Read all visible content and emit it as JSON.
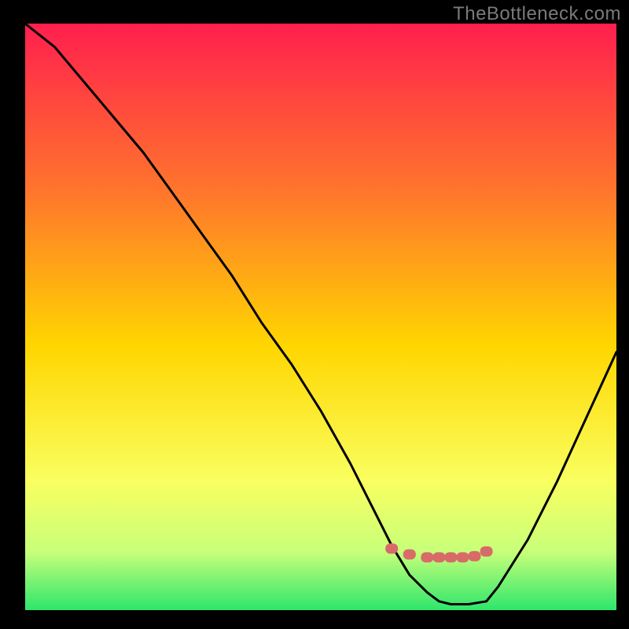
{
  "watermark": "TheBottleneck.com",
  "colors": {
    "black": "#000000",
    "grad_top": "#ff1f4e",
    "grad_mid1": "#ff7a2a",
    "grad_mid2": "#ffd600",
    "grad_mid3": "#f9ff60",
    "grad_bottom1": "#c8ff7a",
    "grad_bottom2": "#2ee66c",
    "curve_stroke": "#000000",
    "marker": "#d86a68"
  },
  "chart_data": {
    "type": "line",
    "title": "",
    "xlabel": "",
    "ylabel": "",
    "xlim": [
      0,
      100
    ],
    "ylim": [
      0,
      100
    ],
    "series": [
      {
        "name": "bottleneck-curve",
        "x": [
          0,
          5,
          10,
          15,
          20,
          25,
          30,
          35,
          40,
          45,
          50,
          55,
          60,
          62,
          65,
          68,
          70,
          72,
          75,
          78,
          80,
          85,
          90,
          95,
          100
        ],
        "values": [
          100,
          96,
          90,
          84,
          78,
          71,
          64,
          57,
          49,
          42,
          34,
          25,
          15,
          11,
          6,
          3,
          1.5,
          1,
          1,
          1.5,
          4,
          12,
          22,
          33,
          44
        ]
      }
    ],
    "markers": {
      "name": "optimal-band",
      "x": [
        62,
        65,
        68,
        70,
        72,
        74,
        76,
        78
      ],
      "values": [
        10.5,
        9.5,
        9.0,
        9.0,
        9.0,
        9.0,
        9.2,
        10.0
      ]
    }
  }
}
